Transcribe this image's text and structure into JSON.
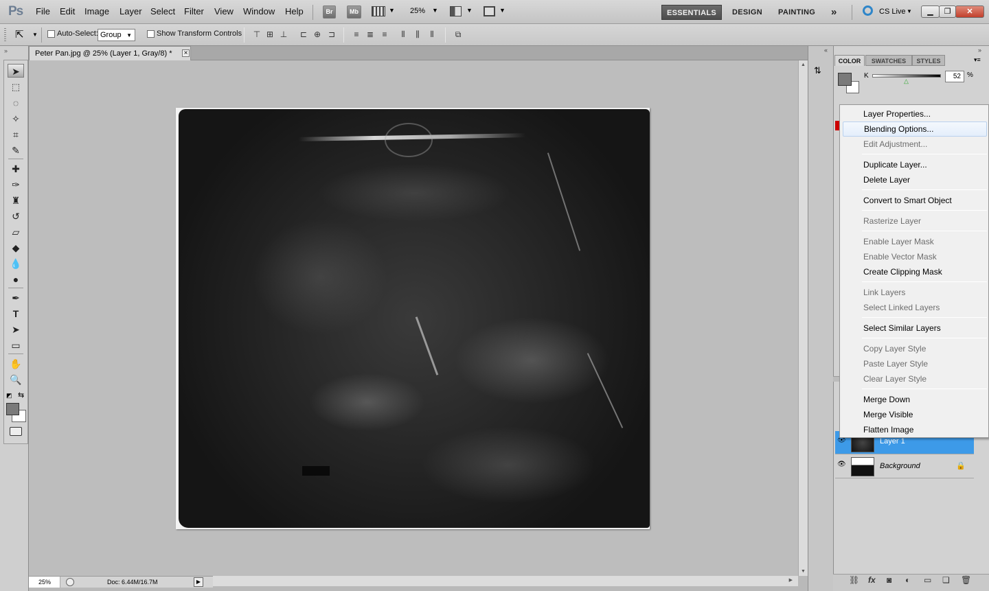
{
  "app": {
    "logo": "Ps",
    "menu": [
      "File",
      "Edit",
      "Image",
      "Layer",
      "Select",
      "Filter",
      "View",
      "Window",
      "Help"
    ],
    "bridge_btn": "Br",
    "minibridge_btn": "Mb",
    "zoom_level": "25%",
    "workspaces": [
      "ESSENTIALS",
      "DESIGN",
      "PAINTING"
    ],
    "more_workspaces": "»",
    "cs_live": "CS Live"
  },
  "options_bar": {
    "auto_select_label": "Auto-Select:",
    "auto_select_value": "Group",
    "transform_label": "Show Transform Controls"
  },
  "document": {
    "tab_title": "Peter Pan.jpg @ 25% (Layer 1, Gray/8) *",
    "close": "×",
    "status_zoom": "25%",
    "doc_info": "Doc: 6.44M/16.7M"
  },
  "color_panel": {
    "tabs": [
      "COLOR",
      "SWATCHES",
      "STYLES"
    ],
    "channel_label": "K",
    "channel_value": "52",
    "unit": "%",
    "foreground": "#7a7a7a",
    "background": "#ffffff"
  },
  "layers": [
    {
      "name": "Layer 1",
      "selected": true
    },
    {
      "name": "Background",
      "selected": false,
      "locked": true
    }
  ],
  "context_menu": {
    "items": [
      {
        "label": "Layer Properties...",
        "enabled": true
      },
      {
        "label": "Blending Options...",
        "enabled": true,
        "hover": true
      },
      {
        "label": "Edit Adjustment...",
        "enabled": false
      },
      {
        "label": "Duplicate Layer...",
        "enabled": true
      },
      {
        "label": "Delete Layer",
        "enabled": true
      },
      {
        "label": "Convert to Smart Object",
        "enabled": true
      },
      {
        "label": "Rasterize Layer",
        "enabled": false
      },
      {
        "label": "Enable Layer Mask",
        "enabled": false
      },
      {
        "label": "Enable Vector Mask",
        "enabled": false
      },
      {
        "label": "Create Clipping Mask",
        "enabled": true
      },
      {
        "label": "Link Layers",
        "enabled": false
      },
      {
        "label": "Select Linked Layers",
        "enabled": false
      },
      {
        "label": "Select Similar Layers",
        "enabled": true
      },
      {
        "label": "Copy Layer Style",
        "enabled": false
      },
      {
        "label": "Paste Layer Style",
        "enabled": false
      },
      {
        "label": "Clear Layer Style",
        "enabled": false
      },
      {
        "label": "Merge Down",
        "enabled": true
      },
      {
        "label": "Merge Visible",
        "enabled": true
      },
      {
        "label": "Flatten Image",
        "enabled": true
      }
    ]
  },
  "colors": {
    "selection_blue": "#3d9ae8",
    "workspace_active": "#5a5a5a"
  }
}
